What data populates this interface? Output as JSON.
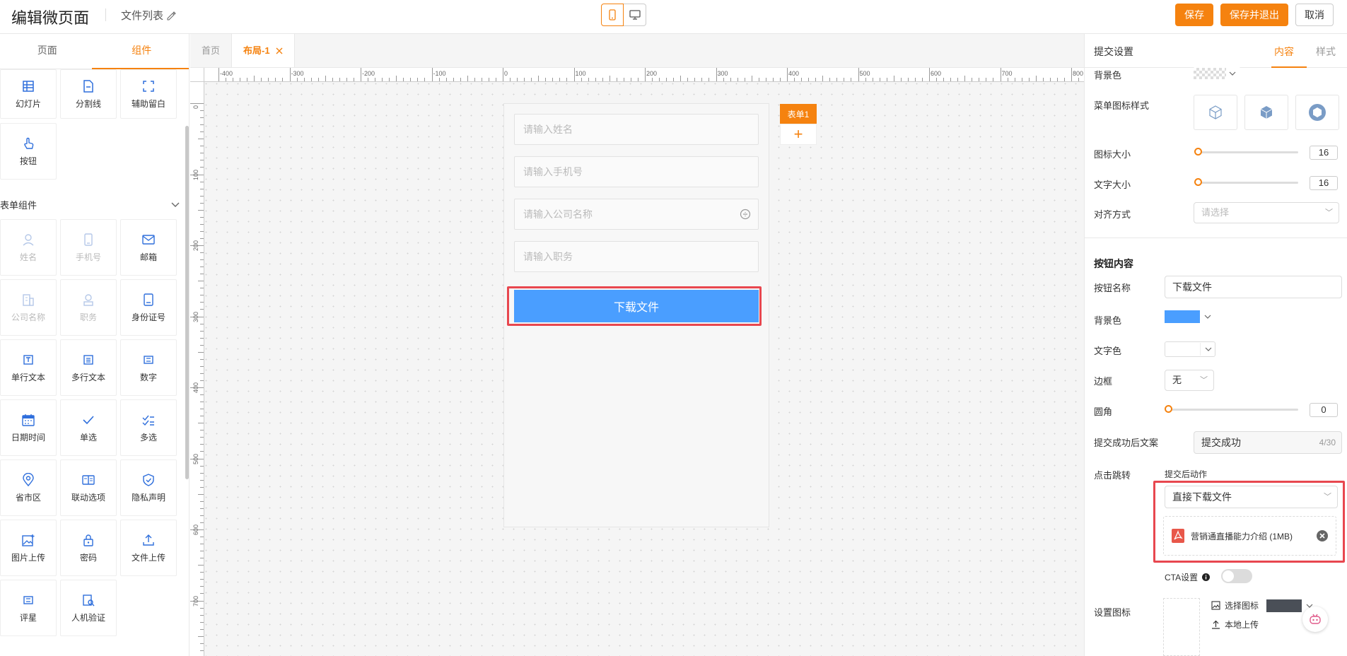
{
  "header": {
    "title": "编辑微页面",
    "file_list": "文件列表",
    "save": "保存",
    "save_exit": "保存并退出",
    "cancel": "取消"
  },
  "left_panel": {
    "tabs": [
      "页面",
      "组件"
    ],
    "top_components": [
      {
        "label": "幻灯片",
        "icon": "slides-icon"
      },
      {
        "label": "分割线",
        "icon": "divider-icon"
      },
      {
        "label": "辅助留白",
        "icon": "whitespace-icon"
      },
      {
        "label": "按钮",
        "icon": "pointer-icon"
      }
    ],
    "form_section": "表单组件",
    "form_components": [
      {
        "label": "姓名",
        "icon": "person-icon",
        "disabled": true
      },
      {
        "label": "手机号",
        "icon": "phone-icon",
        "disabled": true
      },
      {
        "label": "邮箱",
        "icon": "mail-icon",
        "disabled": false
      },
      {
        "label": "公司名称",
        "icon": "building-icon",
        "disabled": true
      },
      {
        "label": "职务",
        "icon": "badge-icon",
        "disabled": true
      },
      {
        "label": "身份证号",
        "icon": "idcard-icon",
        "disabled": false
      },
      {
        "label": "单行文本",
        "icon": "text-icon",
        "disabled": false
      },
      {
        "label": "多行文本",
        "icon": "multitext-icon",
        "disabled": false
      },
      {
        "label": "数字",
        "icon": "number-icon",
        "disabled": false
      },
      {
        "label": "日期时间",
        "icon": "calendar-icon",
        "disabled": false
      },
      {
        "label": "单选",
        "icon": "check-icon",
        "disabled": false
      },
      {
        "label": "多选",
        "icon": "multicheck-icon",
        "disabled": false
      },
      {
        "label": "省市区",
        "icon": "location-icon",
        "disabled": false
      },
      {
        "label": "联动选项",
        "icon": "linked-icon",
        "disabled": false
      },
      {
        "label": "隐私声明",
        "icon": "shield-icon",
        "disabled": false
      },
      {
        "label": "图片上传",
        "icon": "image-upload-icon",
        "disabled": false
      },
      {
        "label": "密码",
        "icon": "lock-icon",
        "disabled": false
      },
      {
        "label": "文件上传",
        "icon": "upload-icon",
        "disabled": false
      },
      {
        "label": "评星",
        "icon": "star-icon",
        "disabled": false
      },
      {
        "label": "人机验证",
        "icon": "captcha-icon",
        "disabled": false
      }
    ]
  },
  "editor_tabs": [
    {
      "label": "首页"
    },
    {
      "label": "布局-1",
      "active": true
    }
  ],
  "canvas": {
    "ruler_x": [
      "-400",
      "-300",
      "-200",
      "-100",
      "0",
      "100",
      "200",
      "300",
      "400",
      "500",
      "600",
      "700",
      "800"
    ],
    "ruler_y": [
      "0",
      "100",
      "200",
      "300",
      "400",
      "500",
      "600",
      "700"
    ],
    "fields": [
      "请输入姓名",
      "请输入手机号",
      "请输入公司名称",
      "请输入职务"
    ],
    "download_button": "下载文件",
    "form_tag": "表单1",
    "add_symbol": "+"
  },
  "right_panel": {
    "title": "提交设置",
    "tabs": [
      "内容",
      "样式"
    ],
    "bg_color_label": "背景色",
    "menu_icon_style_label": "菜单图标样式",
    "icon_size_label": "图标大小",
    "icon_size_value": "16",
    "text_size_label": "文字大小",
    "text_size_value": "16",
    "align_label": "对齐方式",
    "align_placeholder": "请选择",
    "button_content_heading": "按钮内容",
    "button_name_label": "按钮名称",
    "button_name_value": "下载文件",
    "bg_label": "背景色",
    "text_color_label": "文字色",
    "border_label": "边框",
    "border_value": "无",
    "radius_label": "圆角",
    "radius_value": "0",
    "success_text_label": "提交成功后文案",
    "success_text_value": "提交成功",
    "success_text_count": "4/30",
    "click_jump_label": "点击跳转",
    "after_action_label": "提交后动作",
    "after_action_value": "直接下载文件",
    "file_name": "营销通直播能力介绍 (1MB)",
    "cta_label": "CTA设置",
    "set_icon_label": "设置图标",
    "choose_icon": "选择图标",
    "local_upload": "本地上传"
  },
  "colors": {
    "accent": "#f5820f",
    "button_blue": "#4a9eff",
    "highlight_red": "#e8474f"
  }
}
